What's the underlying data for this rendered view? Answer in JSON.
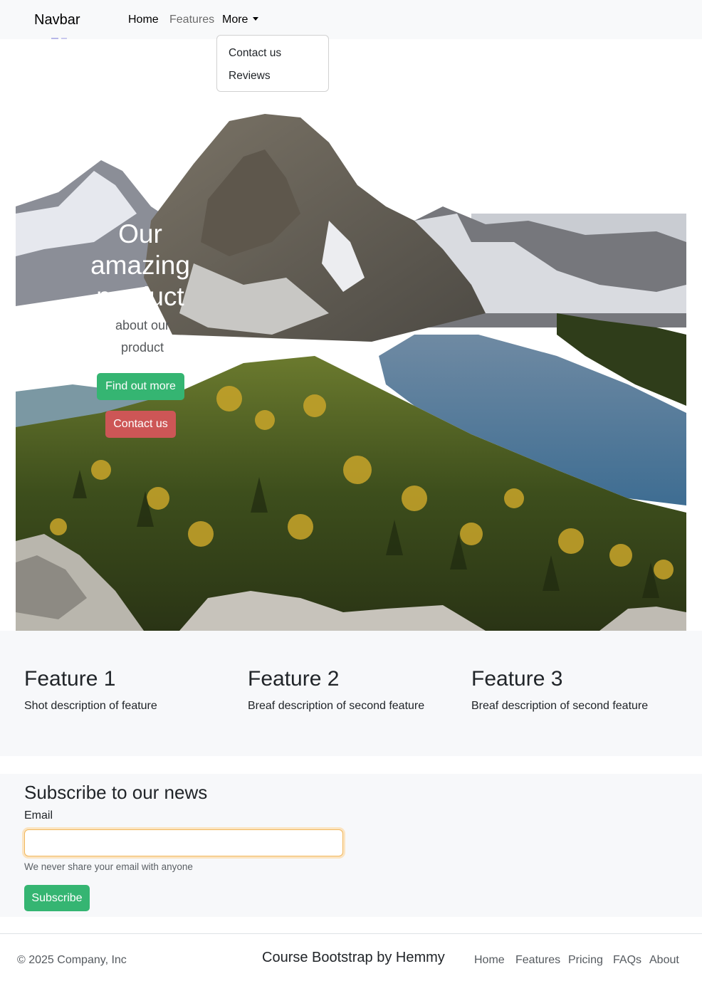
{
  "navbar": {
    "brand": "Navbar",
    "links": {
      "home": "Home",
      "features": "Features",
      "more": "More"
    },
    "dropdown": {
      "items": [
        "Contact us",
        "Reviews"
      ]
    }
  },
  "hero": {
    "title": "Our amazing product",
    "subtitle": "about our product",
    "find_out_more": "Find out more",
    "contact_us": "Contact us"
  },
  "features": [
    {
      "title": "Feature 1",
      "description": "Shot description of feature"
    },
    {
      "title": "Feature 2",
      "description": "Breaf description of second feature"
    },
    {
      "title": "Feature 3",
      "description": "Breaf description of second feature"
    }
  ],
  "subscribe": {
    "heading": "Subscribe to our news",
    "email_label": "Email",
    "email_value": "",
    "help_text": "We never share your email with anyone",
    "button": "Subscribe"
  },
  "footer": {
    "copyright": "© 2025 Company, Inc",
    "title": "Course Bootstrap by Hemmy",
    "links": [
      "Home",
      "Features",
      "Pricing",
      "FAQs",
      "About"
    ]
  },
  "colors": {
    "success": "#35b572",
    "danger": "#cd5656",
    "navbar_bg": "#f8f9fa",
    "section_bg": "#f7f8fa"
  }
}
